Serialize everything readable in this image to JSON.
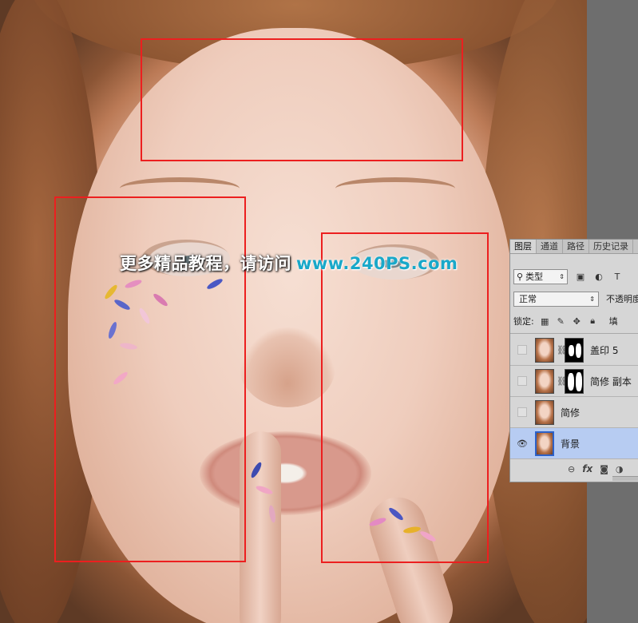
{
  "watermark": {
    "text": "更多精品教程，请访问",
    "url": "www.240PS.com"
  },
  "colors": {
    "selection_box": "#ec1f1f",
    "watermark_url": "#19a8c9",
    "selected_layer": "#b7ccf2",
    "panel_bg": "#d6d6d6"
  },
  "layers_panel": {
    "tabs": [
      "图层",
      "通道",
      "路径",
      "历史记录"
    ],
    "filter": {
      "label": "类型",
      "icon": "search-icon"
    },
    "filter_icons": [
      "image-filter-icon",
      "adjustment-filter-icon",
      "type-filter-icon"
    ],
    "filter_type_glyph": "T",
    "blend_mode": "正常",
    "opacity_label": "不透明度",
    "lock_label": "锁定:",
    "fill_label": "填",
    "layers": [
      {
        "name": "盖印 5",
        "visible": false,
        "mask": true,
        "selected": false
      },
      {
        "name": "简修 副本",
        "visible": false,
        "mask": true,
        "selected": false
      },
      {
        "name": "简修",
        "visible": false,
        "mask": false,
        "selected": false
      },
      {
        "name": "背景",
        "visible": true,
        "mask": false,
        "selected": true
      }
    ],
    "bottom_icons": [
      "link-icon",
      "fx-icon",
      "add-mask-icon",
      "new-adjustment-icon"
    ],
    "fx_label": "fx"
  }
}
